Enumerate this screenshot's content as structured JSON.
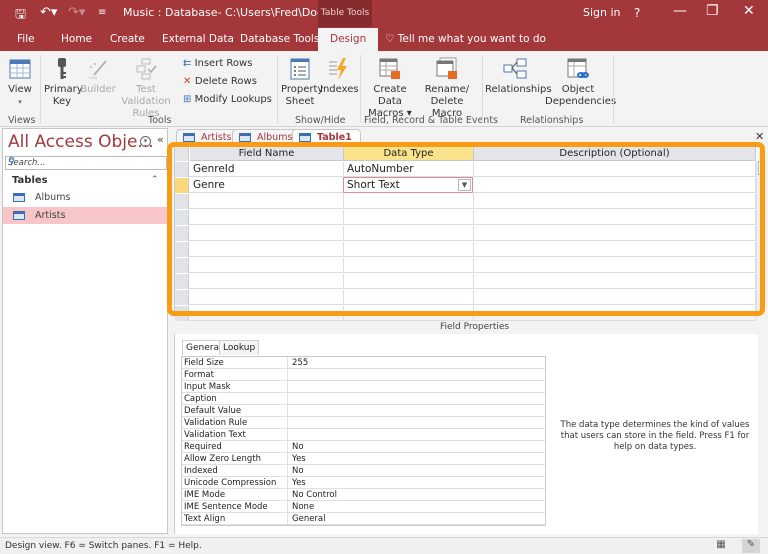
{
  "titlebar": {
    "title": "Music : Database- C:\\Users\\Fred\\Docume...",
    "context_tab": "Table Tools",
    "sign_in": "Sign in",
    "help": "?",
    "minimize": "—",
    "restore": "❐",
    "close": "✕"
  },
  "ribbon_tabs": [
    {
      "label": "File"
    },
    {
      "label": "Home"
    },
    {
      "label": "Create"
    },
    {
      "label": "External Data"
    },
    {
      "label": "Database Tools"
    },
    {
      "label": "Design",
      "active": true
    }
  ],
  "tell_me": "Tell me what you want to do",
  "ribbon": {
    "view": {
      "label": "View",
      "arrow": "▾"
    },
    "primary_key": {
      "line1": "Primary",
      "line2": "Key"
    },
    "builder": {
      "label": "Builder"
    },
    "test_validation": {
      "line1": "Test Validation",
      "line2": "Rules"
    },
    "insert_rows": "Insert Rows",
    "delete_rows": "Delete Rows",
    "modify_lookups": "Modify Lookups",
    "property_sheet": {
      "line1": "Property",
      "line2": "Sheet"
    },
    "indexes": "Indexes",
    "create_data_macros": {
      "line1": "Create Data",
      "line2": "Macros ▾"
    },
    "rename_delete_macro": {
      "line1": "Rename/",
      "line2": "Delete Macro"
    },
    "relationships": "Relationships",
    "object_dependencies": {
      "line1": "Object",
      "line2": "Dependencies"
    },
    "groups": {
      "views": "Views",
      "tools": "Tools",
      "show_hide": "Show/Hide",
      "events": "Field, Record & Table Events",
      "relationships": "Relationships"
    }
  },
  "nav": {
    "title": "All Access Obje...",
    "search_placeholder": "Search...",
    "section": "Tables",
    "items": [
      {
        "label": "Albums",
        "selected": false
      },
      {
        "label": "Artists",
        "selected": true
      }
    ]
  },
  "doc_tabs": [
    {
      "label": "Artists"
    },
    {
      "label": "Albums"
    },
    {
      "label": "Table1",
      "active": true
    }
  ],
  "design_grid": {
    "headers": [
      "Field Name",
      "Data Type",
      "Description (Optional)"
    ],
    "rows": [
      {
        "field": "GenreId",
        "type": "AutoNumber",
        "description": ""
      },
      {
        "field": "Genre",
        "type": "Short Text",
        "description": "",
        "current": true
      }
    ]
  },
  "field_properties": {
    "label": "Field Properties",
    "tabs": [
      "General",
      "Lookup"
    ],
    "rows": [
      {
        "name": "Field Size",
        "value": "255"
      },
      {
        "name": "Format",
        "value": ""
      },
      {
        "name": "Input Mask",
        "value": ""
      },
      {
        "name": "Caption",
        "value": ""
      },
      {
        "name": "Default Value",
        "value": ""
      },
      {
        "name": "Validation Rule",
        "value": ""
      },
      {
        "name": "Validation Text",
        "value": ""
      },
      {
        "name": "Required",
        "value": "No"
      },
      {
        "name": "Allow Zero Length",
        "value": "Yes"
      },
      {
        "name": "Indexed",
        "value": "No"
      },
      {
        "name": "Unicode Compression",
        "value": "Yes"
      },
      {
        "name": "IME Mode",
        "value": "No Control"
      },
      {
        "name": "IME Sentence Mode",
        "value": "None"
      },
      {
        "name": "Text Align",
        "value": "General"
      }
    ],
    "help_text": "The data type determines the kind of values that users can store in the field. Press F1 for help on data types."
  },
  "status": {
    "text": "Design view.  F6 = Switch panes.  F1 = Help."
  },
  "colors": {
    "brand": "#a4373a",
    "highlight": "#f99c15",
    "selected_nav": "#f8c5c8",
    "current_header": "#fbe38b"
  }
}
